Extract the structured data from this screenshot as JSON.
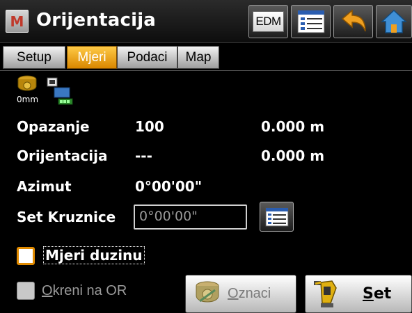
{
  "header": {
    "logo_letter": "M",
    "title": "Orijentacija",
    "edm_label": "EDM",
    "icons": [
      "list-icon",
      "back-arrow-icon",
      "home-icon"
    ]
  },
  "tabs": [
    {
      "label": "Setup",
      "active": false
    },
    {
      "label": "Mjeri",
      "active": true
    },
    {
      "label": "Podaci",
      "active": false
    },
    {
      "label": "Map",
      "active": false
    }
  ],
  "status": {
    "prism_height": "0mm",
    "icons": [
      "prism-icon",
      "instrument-battery-icon"
    ]
  },
  "rows": {
    "opazanje": {
      "label": "Opazanje",
      "value": "100",
      "distance": "0.000 m"
    },
    "orijentacija": {
      "label": "Orijentacija",
      "value": "---",
      "distance": "0.000 m"
    },
    "azimut": {
      "label": "Azimut",
      "value": "0°00'00\""
    },
    "set_kruznice": {
      "label": "Set Kruznice",
      "input_value": "0°00'00\"",
      "icon": "list-icon"
    }
  },
  "checkboxes": {
    "mjeri_duzinu": {
      "label": "Mjeri duzinu",
      "checked": false
    },
    "okreni_na_or": {
      "label_first": "O",
      "label_rest": "kreni na OR",
      "checked": false,
      "enabled": false
    }
  },
  "buttons": {
    "oznaci": {
      "label_first": "O",
      "label_rest": "znaci",
      "enabled": false
    },
    "set": {
      "label_first": "S",
      "label_rest": "et",
      "enabled": true
    }
  },
  "colors": {
    "accent": "#f0a020",
    "background": "#000000"
  }
}
